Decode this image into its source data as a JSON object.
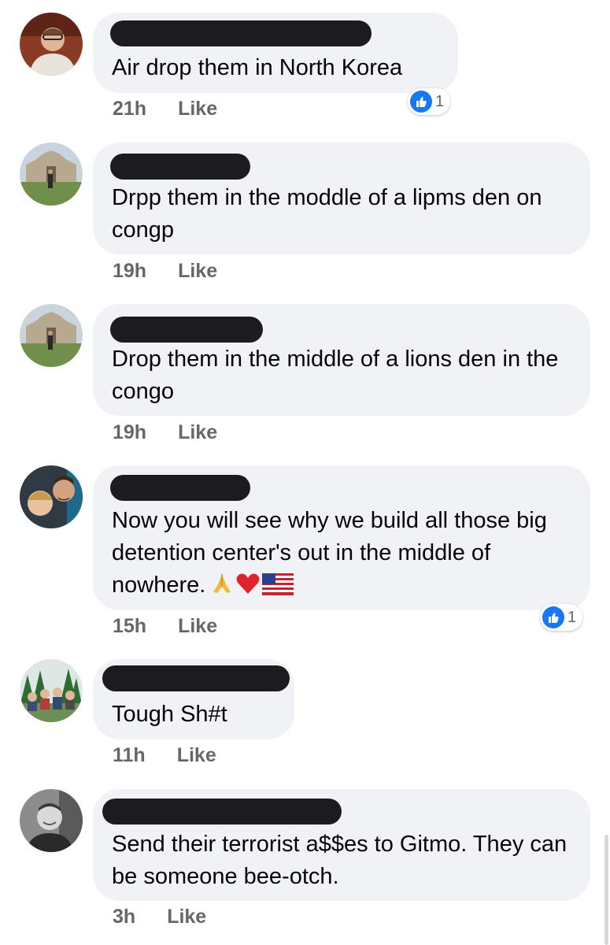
{
  "like_label": "Like",
  "colors": {
    "bubble": "#f0f2f5",
    "meta": "#65676b",
    "like_blue": "#1877f2",
    "redaction": "#1c1c1e"
  },
  "comments": [
    {
      "text": "Air drop them in North Korea",
      "time": "21h",
      "reaction_icon": "thumbs-up-icon",
      "reaction_count": "1"
    },
    {
      "text": "Drpp them in the moddle of a lipms den on congp",
      "time": "19h"
    },
    {
      "text": "Drop them in the middle of a lions den in the congo",
      "time": "19h"
    },
    {
      "text": "Now you will see why we build all those big detention center's out in the middle of nowhere.",
      "emojis": [
        "folded-hands-icon",
        "red-heart-icon",
        "us-flag-icon"
      ],
      "time": "15h",
      "reaction_icon": "thumbs-up-icon",
      "reaction_count": "1"
    },
    {
      "text": "Tough Sh#t",
      "time": "11h"
    },
    {
      "text": "Send their terrorist a$$es to Gitmo. They can be someone bee-otch.",
      "time": "3h"
    }
  ]
}
